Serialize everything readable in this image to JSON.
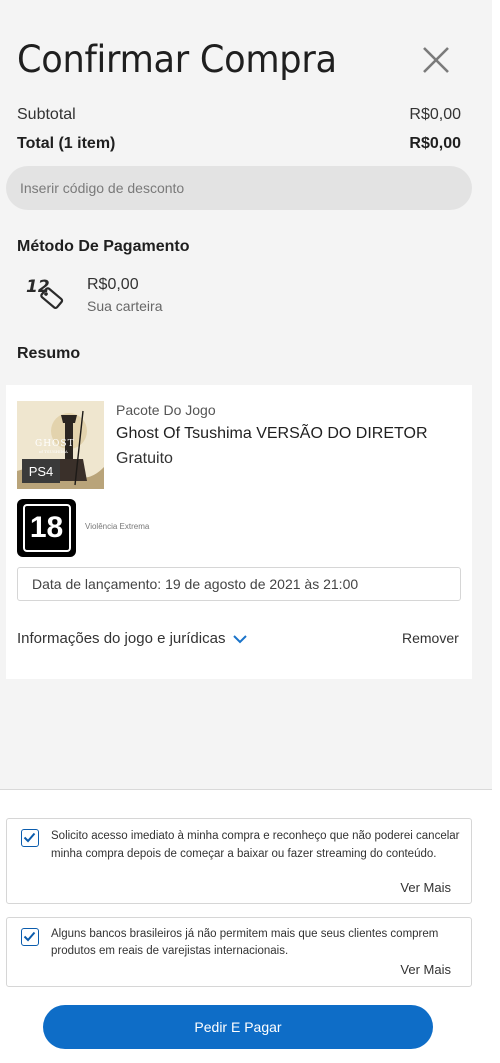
{
  "header": {
    "title": "Confirmar Compra",
    "close_icon": "close-icon"
  },
  "summary": {
    "subtotal_label": "Subtotal",
    "subtotal_value": "R$0,00",
    "total_label": "Total (1 item)",
    "total_value": "R$0,00"
  },
  "discount": {
    "placeholder": "Inserir código de desconto"
  },
  "payment": {
    "title": "Método De Pagamento",
    "icon": "wallet-icon",
    "amount": "R$0,00",
    "label": "Sua carteira"
  },
  "resumo": {
    "title": "Resumo",
    "item": {
      "pack_label": "Pacote Do Jogo",
      "game_title": "Ghost Of Tsushima VERSÃO DO DIRETOR",
      "price": "Gratuito",
      "platform": "PS4",
      "cover_logo": "GHOST",
      "rating": "18",
      "rating_desc": "Violência Extrema",
      "release": "Data de lançamento: 19 de agosto de 2021 às 21:00",
      "info_link": "Informações do jogo e jurídicas",
      "remove": "Remover"
    }
  },
  "consents": [
    {
      "text": "Solicito acesso imediato à minha compra e reconheço que não poderei cancelar minha compra depois de começar a baixar ou fazer streaming do conteúdo.",
      "checked": true,
      "more": "Ver Mais"
    },
    {
      "text": "Alguns bancos brasileiros já não permitem mais que seus clientes comprem produtos em reais de varejistas internacionais.",
      "checked": true,
      "more": "Ver Mais"
    }
  ],
  "footer": {
    "pay_button": "Pedir E Pagar"
  },
  "colors": {
    "accent": "#0e6dc7",
    "checkbox": "#0b5cad",
    "link_chevron": "#1a73c9"
  }
}
